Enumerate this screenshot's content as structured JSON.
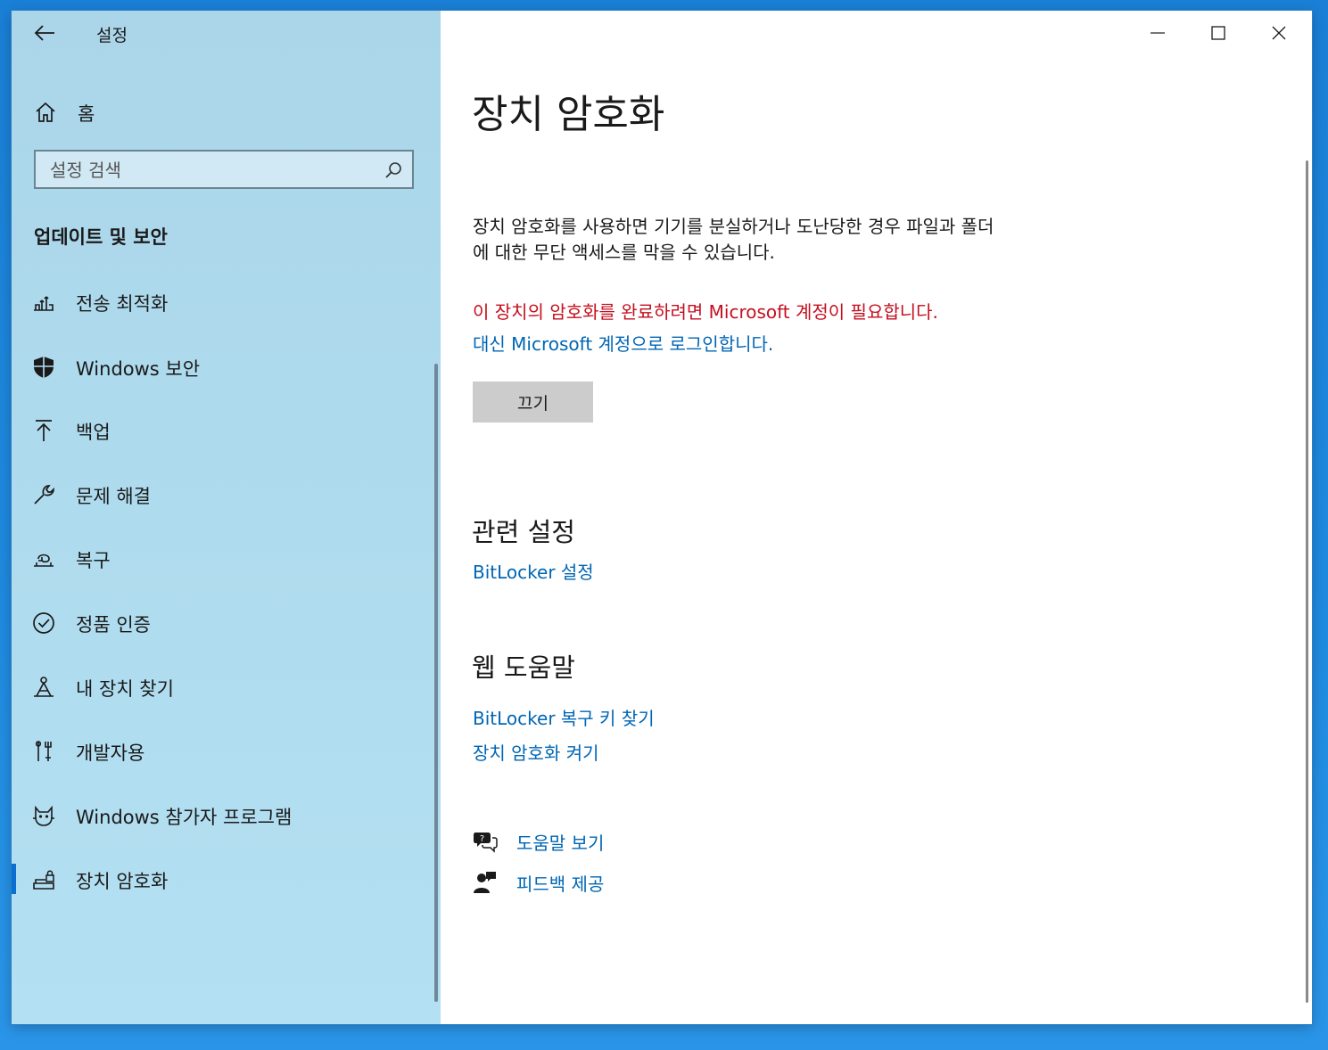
{
  "window": {
    "title": "설정"
  },
  "sidebar": {
    "home_label": "홈",
    "search_placeholder": "설정 검색",
    "section_title": "업데이트 및 보안",
    "items": [
      {
        "label": "전송 최적화",
        "icon": "delivery-optimization-icon"
      },
      {
        "label": "Windows 보안",
        "icon": "shield-icon"
      },
      {
        "label": "백업",
        "icon": "backup-arrow-icon"
      },
      {
        "label": "문제 해결",
        "icon": "wrench-icon"
      },
      {
        "label": "복구",
        "icon": "recovery-icon"
      },
      {
        "label": "정품 인증",
        "icon": "check-circle-icon"
      },
      {
        "label": "내 장치 찾기",
        "icon": "find-device-icon"
      },
      {
        "label": "개발자용",
        "icon": "developer-icon"
      },
      {
        "label": "Windows 참가자 프로그램",
        "icon": "insider-icon"
      },
      {
        "label": "장치 암호화",
        "icon": "device-encryption-icon",
        "selected": true
      }
    ]
  },
  "main": {
    "title": "장치 암호화",
    "description_line1": "장치 암호화를 사용하면 기기를 분실하거나 도난당한 경우 파일과 폴더",
    "description_line2": "에 대한 무단 액세스를 막을 수 있습니다.",
    "warning": "이 장치의 암호화를 완료하려면 Microsoft 계정이 필요합니다.",
    "signin_link": "대신 Microsoft 계정으로 로그인합니다.",
    "off_button": "끄기",
    "related_title": "관련 설정",
    "bitlocker_settings_link": "BitLocker 설정",
    "web_help_title": "웹 도움말",
    "web_help_links": [
      "BitLocker 복구 키 찾기",
      "장치 암호화 켜기"
    ],
    "get_help": "도움말 보기",
    "give_feedback": "피드백 제공"
  },
  "colors": {
    "accent": "#0066b4",
    "warning": "#c50f1f",
    "sidebar_bg": "#b3e0f2"
  }
}
